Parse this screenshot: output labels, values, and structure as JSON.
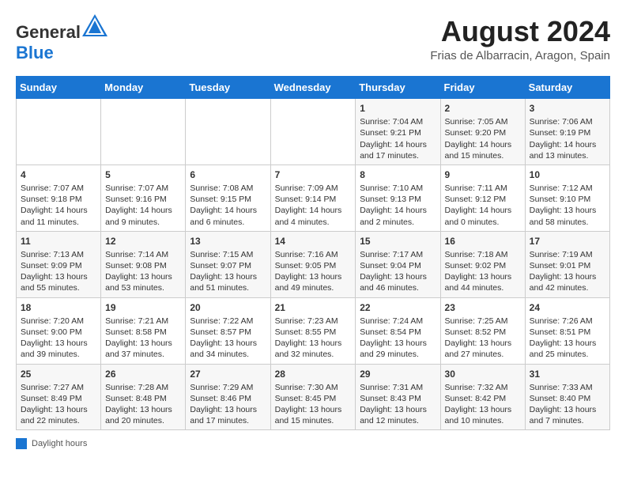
{
  "header": {
    "logo_general": "General",
    "logo_blue": "Blue",
    "month_year": "August 2024",
    "location": "Frias de Albarracin, Aragon, Spain"
  },
  "calendar": {
    "days_of_week": [
      "Sunday",
      "Monday",
      "Tuesday",
      "Wednesday",
      "Thursday",
      "Friday",
      "Saturday"
    ],
    "weeks": [
      [
        {
          "day": "",
          "info": ""
        },
        {
          "day": "",
          "info": ""
        },
        {
          "day": "",
          "info": ""
        },
        {
          "day": "",
          "info": ""
        },
        {
          "day": "1",
          "info": "Sunrise: 7:04 AM\nSunset: 9:21 PM\nDaylight: 14 hours and 17 minutes."
        },
        {
          "day": "2",
          "info": "Sunrise: 7:05 AM\nSunset: 9:20 PM\nDaylight: 14 hours and 15 minutes."
        },
        {
          "day": "3",
          "info": "Sunrise: 7:06 AM\nSunset: 9:19 PM\nDaylight: 14 hours and 13 minutes."
        }
      ],
      [
        {
          "day": "4",
          "info": "Sunrise: 7:07 AM\nSunset: 9:18 PM\nDaylight: 14 hours and 11 minutes."
        },
        {
          "day": "5",
          "info": "Sunrise: 7:07 AM\nSunset: 9:16 PM\nDaylight: 14 hours and 9 minutes."
        },
        {
          "day": "6",
          "info": "Sunrise: 7:08 AM\nSunset: 9:15 PM\nDaylight: 14 hours and 6 minutes."
        },
        {
          "day": "7",
          "info": "Sunrise: 7:09 AM\nSunset: 9:14 PM\nDaylight: 14 hours and 4 minutes."
        },
        {
          "day": "8",
          "info": "Sunrise: 7:10 AM\nSunset: 9:13 PM\nDaylight: 14 hours and 2 minutes."
        },
        {
          "day": "9",
          "info": "Sunrise: 7:11 AM\nSunset: 9:12 PM\nDaylight: 14 hours and 0 minutes."
        },
        {
          "day": "10",
          "info": "Sunrise: 7:12 AM\nSunset: 9:10 PM\nDaylight: 13 hours and 58 minutes."
        }
      ],
      [
        {
          "day": "11",
          "info": "Sunrise: 7:13 AM\nSunset: 9:09 PM\nDaylight: 13 hours and 55 minutes."
        },
        {
          "day": "12",
          "info": "Sunrise: 7:14 AM\nSunset: 9:08 PM\nDaylight: 13 hours and 53 minutes."
        },
        {
          "day": "13",
          "info": "Sunrise: 7:15 AM\nSunset: 9:07 PM\nDaylight: 13 hours and 51 minutes."
        },
        {
          "day": "14",
          "info": "Sunrise: 7:16 AM\nSunset: 9:05 PM\nDaylight: 13 hours and 49 minutes."
        },
        {
          "day": "15",
          "info": "Sunrise: 7:17 AM\nSunset: 9:04 PM\nDaylight: 13 hours and 46 minutes."
        },
        {
          "day": "16",
          "info": "Sunrise: 7:18 AM\nSunset: 9:02 PM\nDaylight: 13 hours and 44 minutes."
        },
        {
          "day": "17",
          "info": "Sunrise: 7:19 AM\nSunset: 9:01 PM\nDaylight: 13 hours and 42 minutes."
        }
      ],
      [
        {
          "day": "18",
          "info": "Sunrise: 7:20 AM\nSunset: 9:00 PM\nDaylight: 13 hours and 39 minutes."
        },
        {
          "day": "19",
          "info": "Sunrise: 7:21 AM\nSunset: 8:58 PM\nDaylight: 13 hours and 37 minutes."
        },
        {
          "day": "20",
          "info": "Sunrise: 7:22 AM\nSunset: 8:57 PM\nDaylight: 13 hours and 34 minutes."
        },
        {
          "day": "21",
          "info": "Sunrise: 7:23 AM\nSunset: 8:55 PM\nDaylight: 13 hours and 32 minutes."
        },
        {
          "day": "22",
          "info": "Sunrise: 7:24 AM\nSunset: 8:54 PM\nDaylight: 13 hours and 29 minutes."
        },
        {
          "day": "23",
          "info": "Sunrise: 7:25 AM\nSunset: 8:52 PM\nDaylight: 13 hours and 27 minutes."
        },
        {
          "day": "24",
          "info": "Sunrise: 7:26 AM\nSunset: 8:51 PM\nDaylight: 13 hours and 25 minutes."
        }
      ],
      [
        {
          "day": "25",
          "info": "Sunrise: 7:27 AM\nSunset: 8:49 PM\nDaylight: 13 hours and 22 minutes."
        },
        {
          "day": "26",
          "info": "Sunrise: 7:28 AM\nSunset: 8:48 PM\nDaylight: 13 hours and 20 minutes."
        },
        {
          "day": "27",
          "info": "Sunrise: 7:29 AM\nSunset: 8:46 PM\nDaylight: 13 hours and 17 minutes."
        },
        {
          "day": "28",
          "info": "Sunrise: 7:30 AM\nSunset: 8:45 PM\nDaylight: 13 hours and 15 minutes."
        },
        {
          "day": "29",
          "info": "Sunrise: 7:31 AM\nSunset: 8:43 PM\nDaylight: 13 hours and 12 minutes."
        },
        {
          "day": "30",
          "info": "Sunrise: 7:32 AM\nSunset: 8:42 PM\nDaylight: 13 hours and 10 minutes."
        },
        {
          "day": "31",
          "info": "Sunrise: 7:33 AM\nSunset: 8:40 PM\nDaylight: 13 hours and 7 minutes."
        }
      ]
    ]
  },
  "footer": {
    "legend_label": "Daylight hours"
  }
}
